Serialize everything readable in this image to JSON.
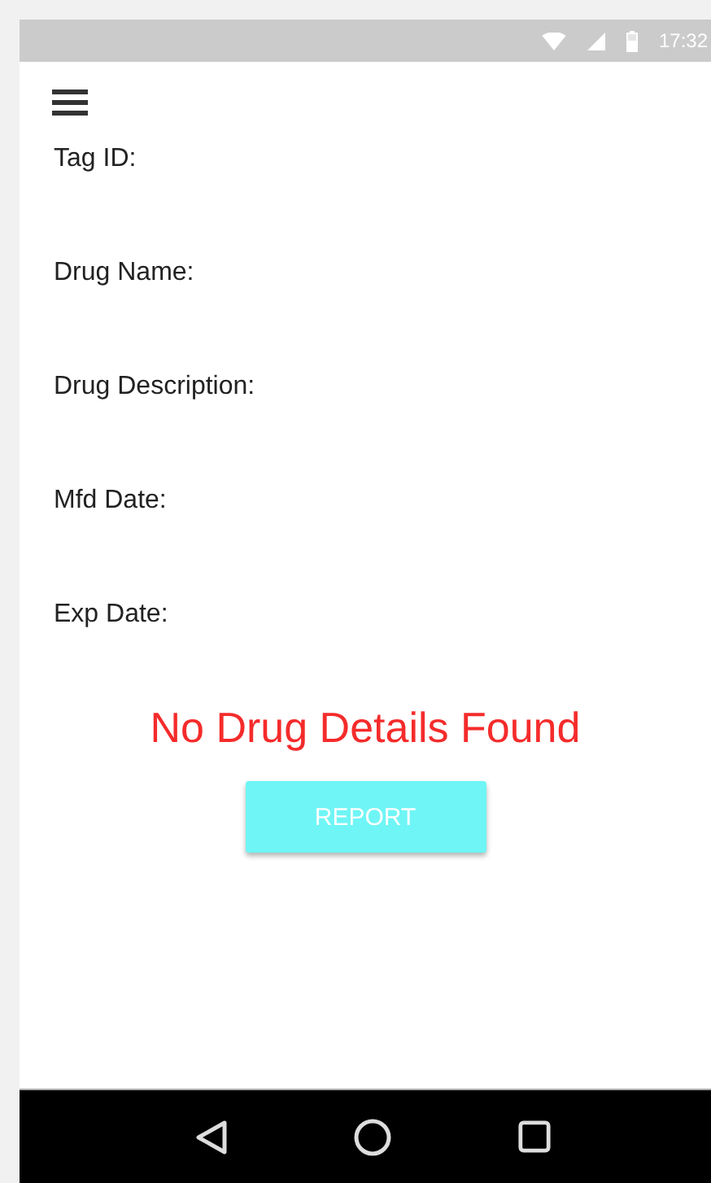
{
  "status_bar": {
    "time": "17:32"
  },
  "fields": [
    {
      "label": "Tag ID:"
    },
    {
      "label": "Drug Name:"
    },
    {
      "label": "Drug Description:"
    },
    {
      "label": "Mfd Date:"
    },
    {
      "label": "Exp Date:"
    }
  ],
  "message": "No Drug Details Found",
  "report_button": {
    "label": "REPORT"
  }
}
